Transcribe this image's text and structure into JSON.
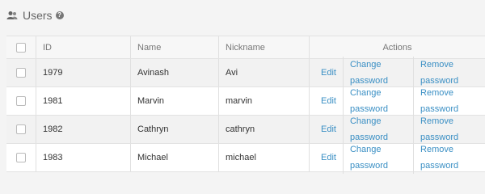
{
  "header": {
    "title": "Users",
    "users_icon": "users-icon",
    "help_icon": "help-icon",
    "help_glyph": "?"
  },
  "columns": {
    "id": "ID",
    "name": "Name",
    "nickname": "Nickname",
    "actions": "Actions"
  },
  "rows": [
    {
      "id": "1979",
      "name": "Avinash",
      "nickname": "Avi"
    },
    {
      "id": "1981",
      "name": "Marvin",
      "nickname": "marvin"
    },
    {
      "id": "1982",
      "name": "Cathryn",
      "nickname": "cathryn"
    },
    {
      "id": "1983",
      "name": "Michael",
      "nickname": "michael"
    }
  ],
  "actions": {
    "edit": "Edit",
    "change_password": "Change password",
    "remove_password": "Remove password"
  },
  "colors": {
    "link": "#3a8fc4",
    "row_shaded": "#f2f2f2",
    "background": "#f4f4f4"
  }
}
